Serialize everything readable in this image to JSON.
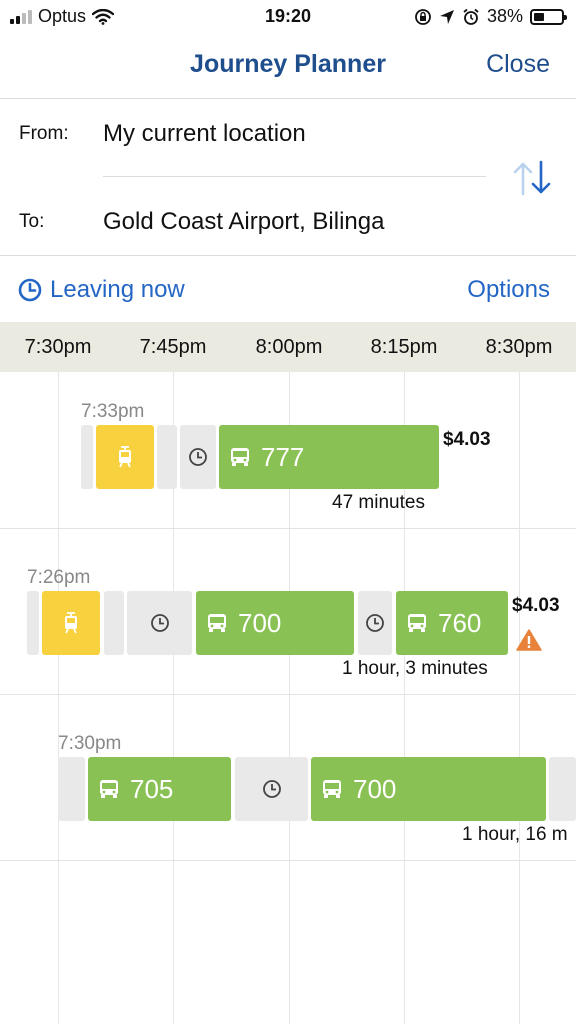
{
  "status_bar": {
    "carrier": "Optus",
    "time": "19:20",
    "battery_percent": "38%",
    "battery_level": 0.38
  },
  "nav": {
    "title": "Journey Planner",
    "close_label": "Close"
  },
  "route": {
    "from_label": "From:",
    "from_value": "My current location",
    "to_label": "To:",
    "to_value": "Gold Coast Airport, Bilinga"
  },
  "time_options": {
    "leaving_label": "Leaving now",
    "options_label": "Options"
  },
  "timeline": {
    "ticks": [
      "7:30pm",
      "7:45pm",
      "8:00pm",
      "8:15pm",
      "8:30pm"
    ]
  },
  "trips": [
    {
      "depart_time": "7:33pm",
      "price": "$4.03",
      "duration": "47 minutes",
      "segments": [
        {
          "type": "walk"
        },
        {
          "type": "tram"
        },
        {
          "type": "walk"
        },
        {
          "type": "wait"
        },
        {
          "type": "bus",
          "route": "777"
        }
      ]
    },
    {
      "depart_time": "7:26pm",
      "price": "$4.03",
      "duration": "1 hour, 3 minutes",
      "warning": true,
      "segments": [
        {
          "type": "walk"
        },
        {
          "type": "tram"
        },
        {
          "type": "walk"
        },
        {
          "type": "wait"
        },
        {
          "type": "bus",
          "route": "700"
        },
        {
          "type": "wait"
        },
        {
          "type": "bus",
          "route": "760"
        }
      ]
    },
    {
      "depart_time": "7:30pm",
      "duration": "1 hour, 16 m",
      "segments": [
        {
          "type": "walk"
        },
        {
          "type": "bus",
          "route": "705"
        },
        {
          "type": "wait"
        },
        {
          "type": "bus",
          "route": "700"
        },
        {
          "type": "walk"
        }
      ]
    }
  ],
  "colors": {
    "accent": "#2466c5",
    "nav_title": "#1f4e8c",
    "bus": "#89c154",
    "tram": "#f7d23e",
    "walk_wait": "#e9e9e9",
    "warning": "#e8823a"
  }
}
